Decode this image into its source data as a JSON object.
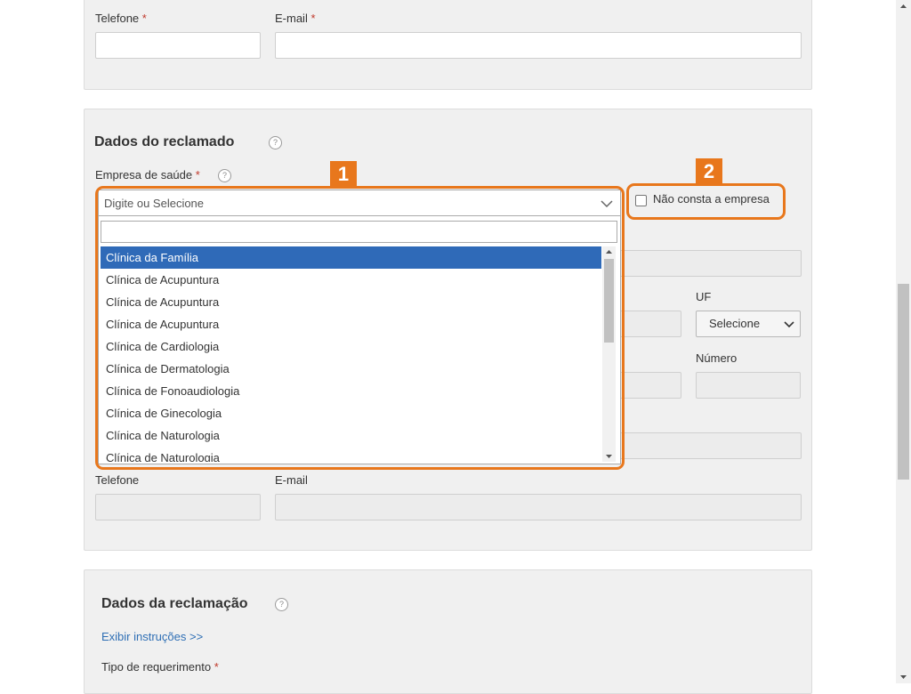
{
  "contact_section": {
    "telefone_label": "Telefone",
    "email_label": "E-mail",
    "required_mark": "*"
  },
  "reclamado": {
    "title": "Dados do reclamado",
    "help_glyph": "?",
    "empresa_label": "Empresa de saúde",
    "required_mark": "*",
    "select_placeholder": "Digite ou Selecione",
    "search_value": "",
    "options": [
      "Clínica da Família",
      "Clínica de Acupuntura",
      "Clínica de Acupuntura",
      "Clínica de Acupuntura",
      "Clínica de Cardiologia",
      "Clínica de Dermatologia",
      "Clínica de Fonoaudiologia",
      "Clínica de Ginecologia",
      "Clínica de Naturologia",
      "Clínica de Naturologia"
    ],
    "selected_option": "Clínica da Família",
    "checkbox_label": "Não consta a empresa",
    "checkbox_checked": false,
    "uf_label": "UF",
    "uf_value": "Selecione",
    "numero_label": "Número",
    "telefone_label": "Telefone",
    "email_label": "E-mail"
  },
  "annotations": {
    "badge_1": "1",
    "badge_2": "2",
    "highlight_color": "#e8771c"
  },
  "reclamacao": {
    "title": "Dados da reclamação",
    "help_glyph": "?",
    "instructions_link": "Exibir instruções >>",
    "tipo_label": "Tipo de requerimento",
    "required_mark": "*"
  },
  "colors": {
    "panel_bg": "#f0f0f0",
    "selected_bg": "#2f6ab8",
    "link": "#2f6fb5",
    "required": "#c0392b"
  }
}
